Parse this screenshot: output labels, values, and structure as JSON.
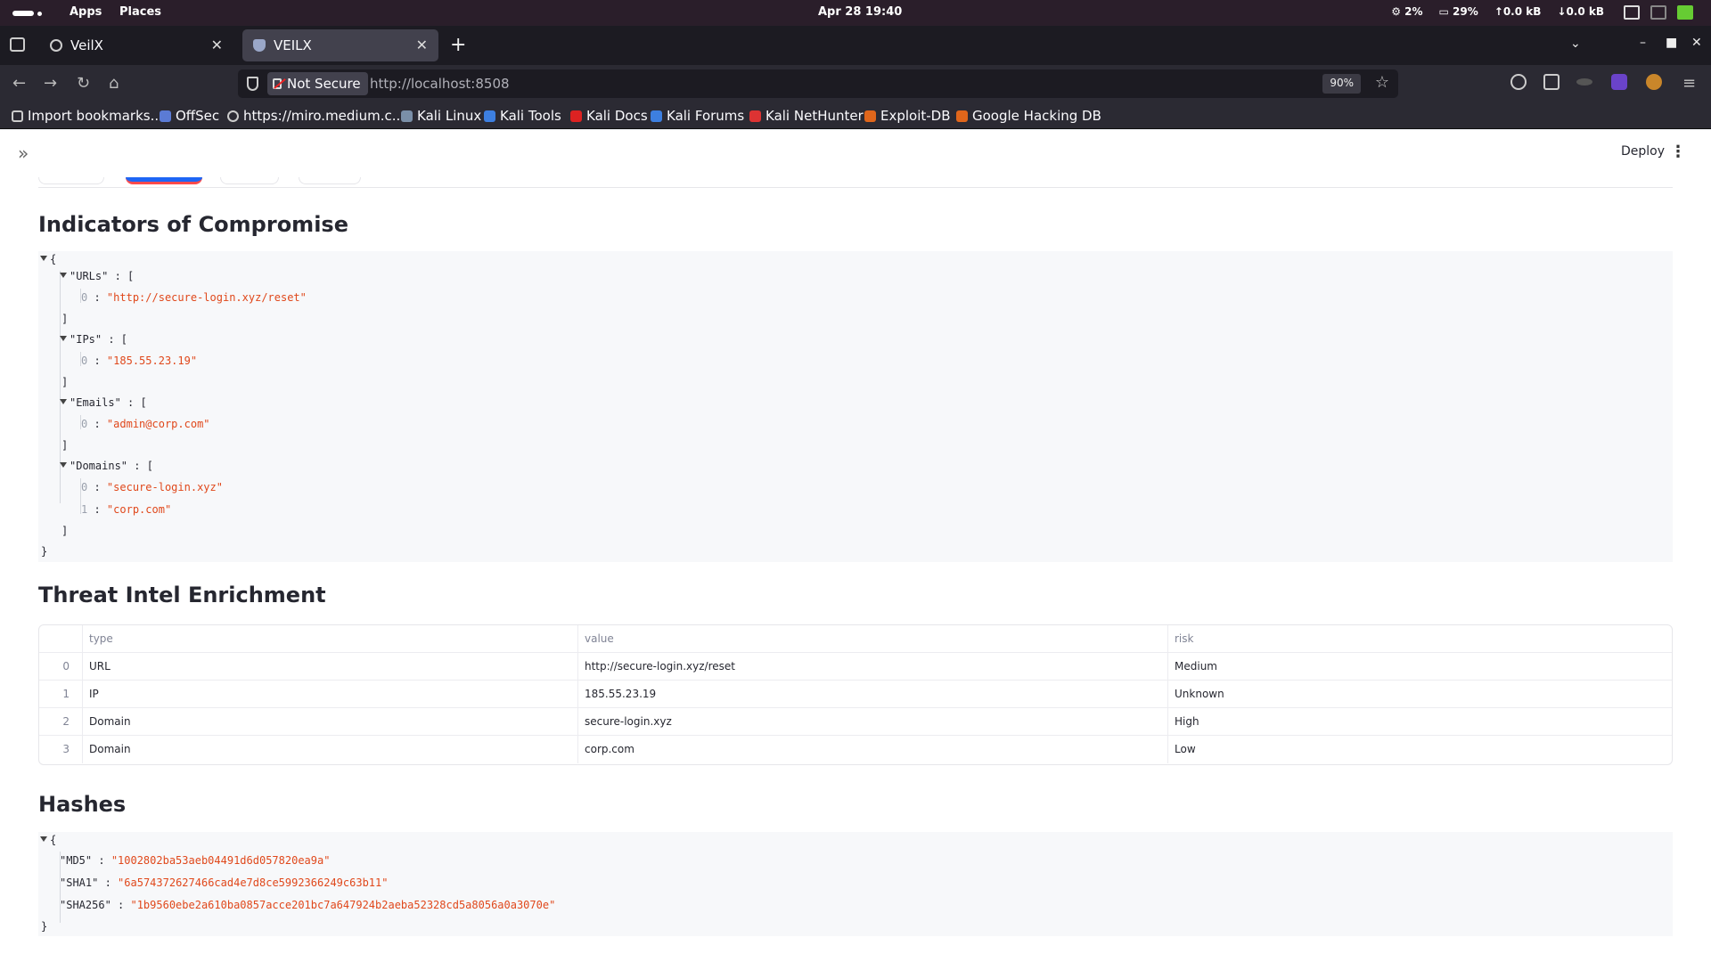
{
  "os": {
    "menus": [
      "Apps",
      "Places"
    ],
    "clock": "Apr 28  19:40",
    "cpu": "2%",
    "mem": "29%",
    "net_up": "0.0 kB",
    "net_down": "0.0 kB"
  },
  "browser": {
    "tabs": [
      {
        "title": "VeilX",
        "active": false
      },
      {
        "title": "VEILX",
        "active": true
      }
    ],
    "security_label": "Not Secure",
    "url_host": "http://localhost",
    "url_port": ":8508",
    "zoom": "90%",
    "bookmarks": [
      "Import bookmarks...",
      "OffSec",
      "https://miro.medium.c...",
      "Kali Linux",
      "Kali Tools",
      "Kali Docs",
      "Kali Forums",
      "Kali NetHunter",
      "Exploit-DB",
      "Google Hacking DB"
    ]
  },
  "app": {
    "deploy_label": "Deploy",
    "ioc_title": "Indicators of Compromise",
    "enrich_title": "Threat Intel Enrichment",
    "hashes_title": "Hashes"
  },
  "ioc": {
    "urls_key": "\"URLs\"",
    "urls": [
      "\"http://secure-login.xyz/reset\""
    ],
    "ips_key": "\"IPs\"",
    "ips": [
      "\"185.55.23.19\""
    ],
    "emails_key": "\"Emails\"",
    "emails": [
      "\"admin@corp.com\""
    ],
    "domains_key": "\"Domains\"",
    "domains": [
      "\"secure-login.xyz\"",
      "\"corp.com\""
    ]
  },
  "enrichment": {
    "columns": [
      "type",
      "value",
      "risk"
    ],
    "rows": [
      {
        "index": "0",
        "type": "URL",
        "value": "http://secure-login.xyz/reset",
        "risk": "Medium"
      },
      {
        "index": "1",
        "type": "IP",
        "value": "185.55.23.19",
        "risk": "Unknown"
      },
      {
        "index": "2",
        "type": "Domain",
        "value": "secure-login.xyz",
        "risk": "High"
      },
      {
        "index": "3",
        "type": "Domain",
        "value": "corp.com",
        "risk": "Low"
      }
    ]
  },
  "hashes": {
    "md5_key": "\"MD5\"",
    "md5": "\"1002802ba53aeb04491d6d057820ea9a\"",
    "sha1_key": "\"SHA1\"",
    "sha1": "\"6a574372627466cad4e7d8ce5992366249c63b11\"",
    "sha256_key": "\"SHA256\"",
    "sha256": "\"1b9560ebe2a610ba0857acce201bc7a647924b2aeba52328cd5a8056a0a3070e\""
  }
}
